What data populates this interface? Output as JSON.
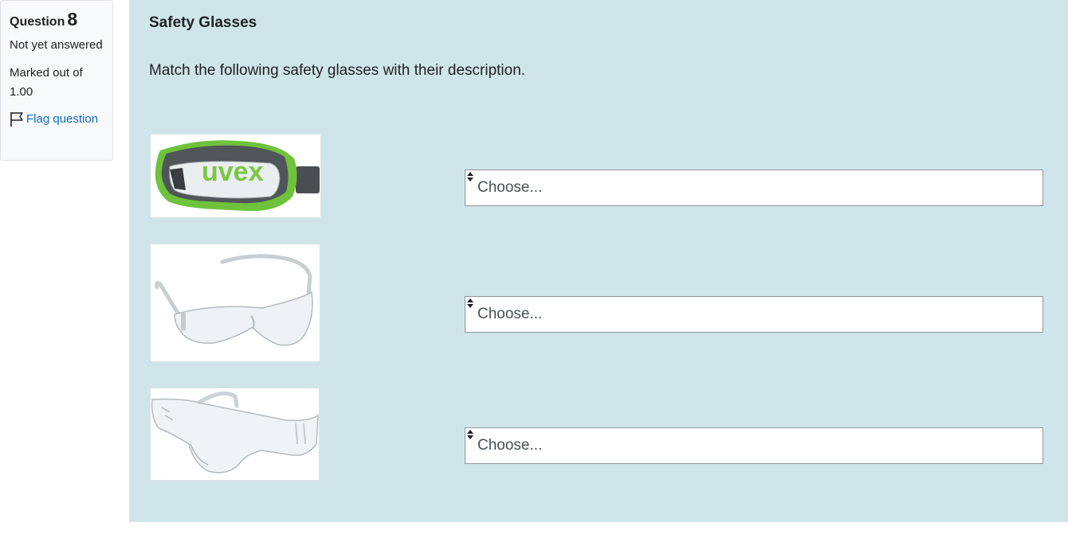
{
  "info": {
    "question_label": "Question",
    "question_number": "8",
    "state": "Not yet answered",
    "grade": "Marked out of 1.00",
    "flag_label": "Flag question"
  },
  "question": {
    "title": "Safety Glasses",
    "text": "Match the following safety glasses with their description.",
    "items": [
      {
        "image_brand_text": "uvex",
        "select_value": "Choose..."
      },
      {
        "select_value": "Choose..."
      },
      {
        "select_value": "Choose..."
      }
    ]
  },
  "colors": {
    "content_bg": "#cfe5ea",
    "link": "#0f6cbf",
    "info_bg": "#f8f9fa"
  },
  "icons": {
    "flag": "flag-outline-icon",
    "select_arrows": "up-down-arrows-icon"
  }
}
